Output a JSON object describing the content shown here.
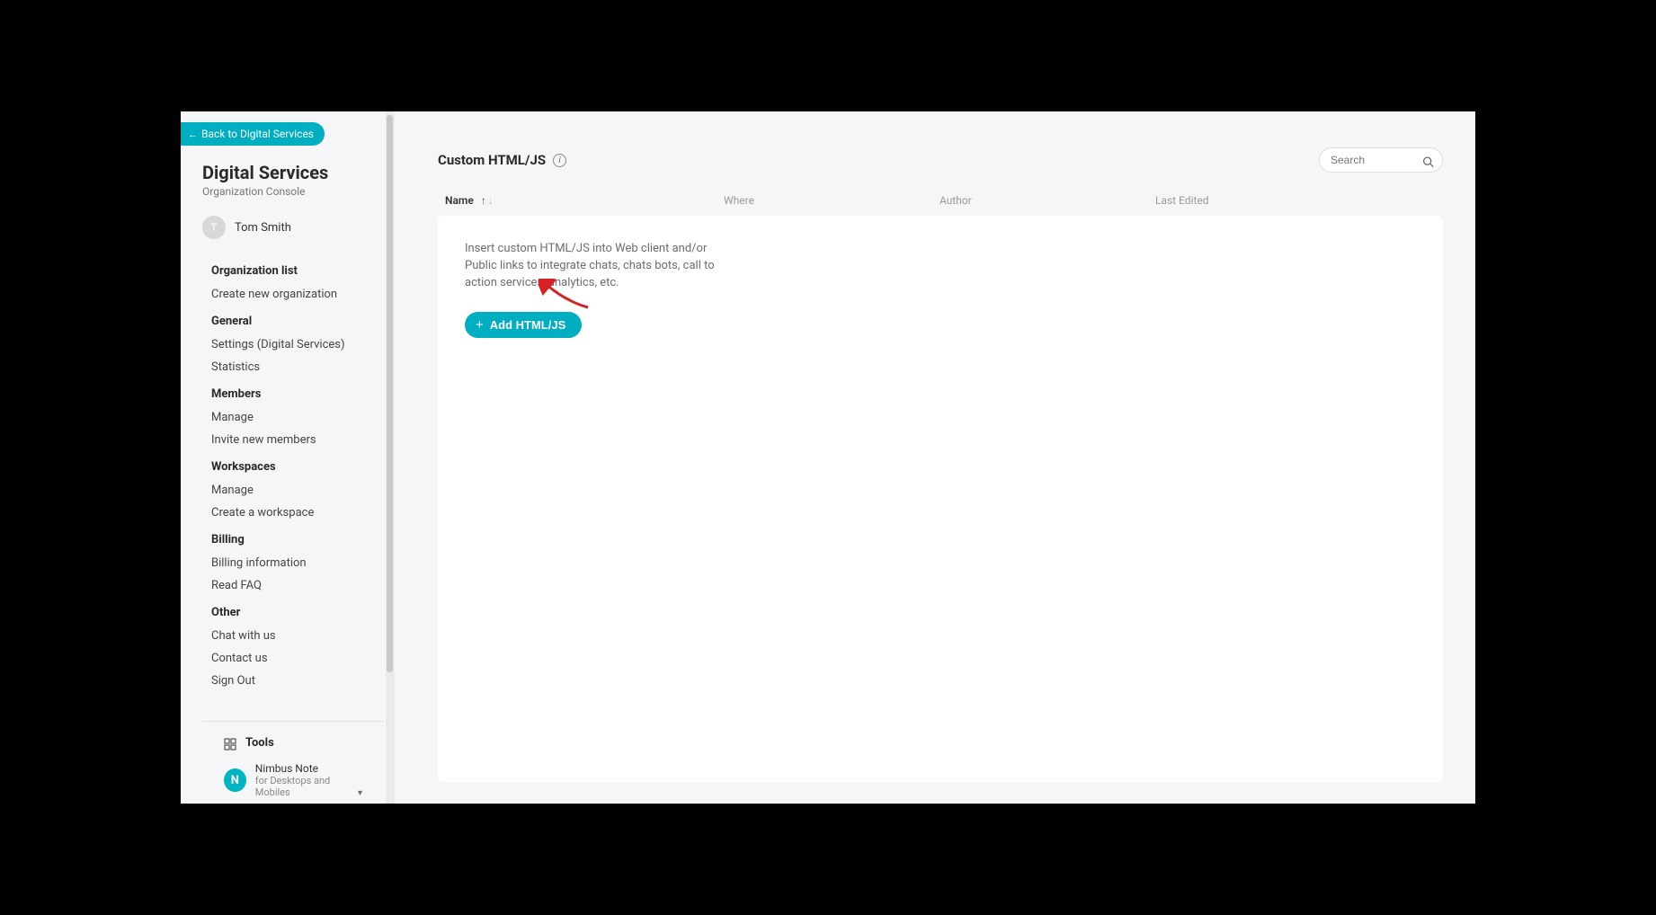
{
  "back_button": "Back to Digital Services",
  "brand": {
    "title": "Digital Services",
    "subtitle": "Organization Console"
  },
  "user": {
    "initial": "T",
    "name": "Tom Smith"
  },
  "nav": {
    "org": {
      "head": "Organization list",
      "create": "Create new organization"
    },
    "general": {
      "head": "General",
      "settings": "Settings (Digital Services)",
      "stats": "Statistics"
    },
    "members": {
      "head": "Members",
      "manage": "Manage",
      "invite": "Invite new members"
    },
    "workspaces": {
      "head": "Workspaces",
      "manage": "Manage",
      "create": "Create a workspace"
    },
    "billing": {
      "head": "Billing",
      "info": "Billing information",
      "faq": "Read FAQ"
    },
    "other": {
      "head": "Other",
      "chat": "Chat with us",
      "contact": "Contact us",
      "signout": "Sign Out"
    }
  },
  "tools": {
    "label": "Tools"
  },
  "product": {
    "logo_letter": "N",
    "name": "Nimbus Note",
    "sub": "for Desktops and Mobiles"
  },
  "page": {
    "title": "Custom HTML/JS",
    "search_placeholder": "Search"
  },
  "columns": {
    "name": "Name",
    "where": "Where",
    "author": "Author",
    "last": "Last Edited"
  },
  "hint": "Insert custom HTML/JS into Web client and/or Public links to integrate chats, chats bots, call to action services, analytics, etc.",
  "add_button": "Add HTML/JS"
}
